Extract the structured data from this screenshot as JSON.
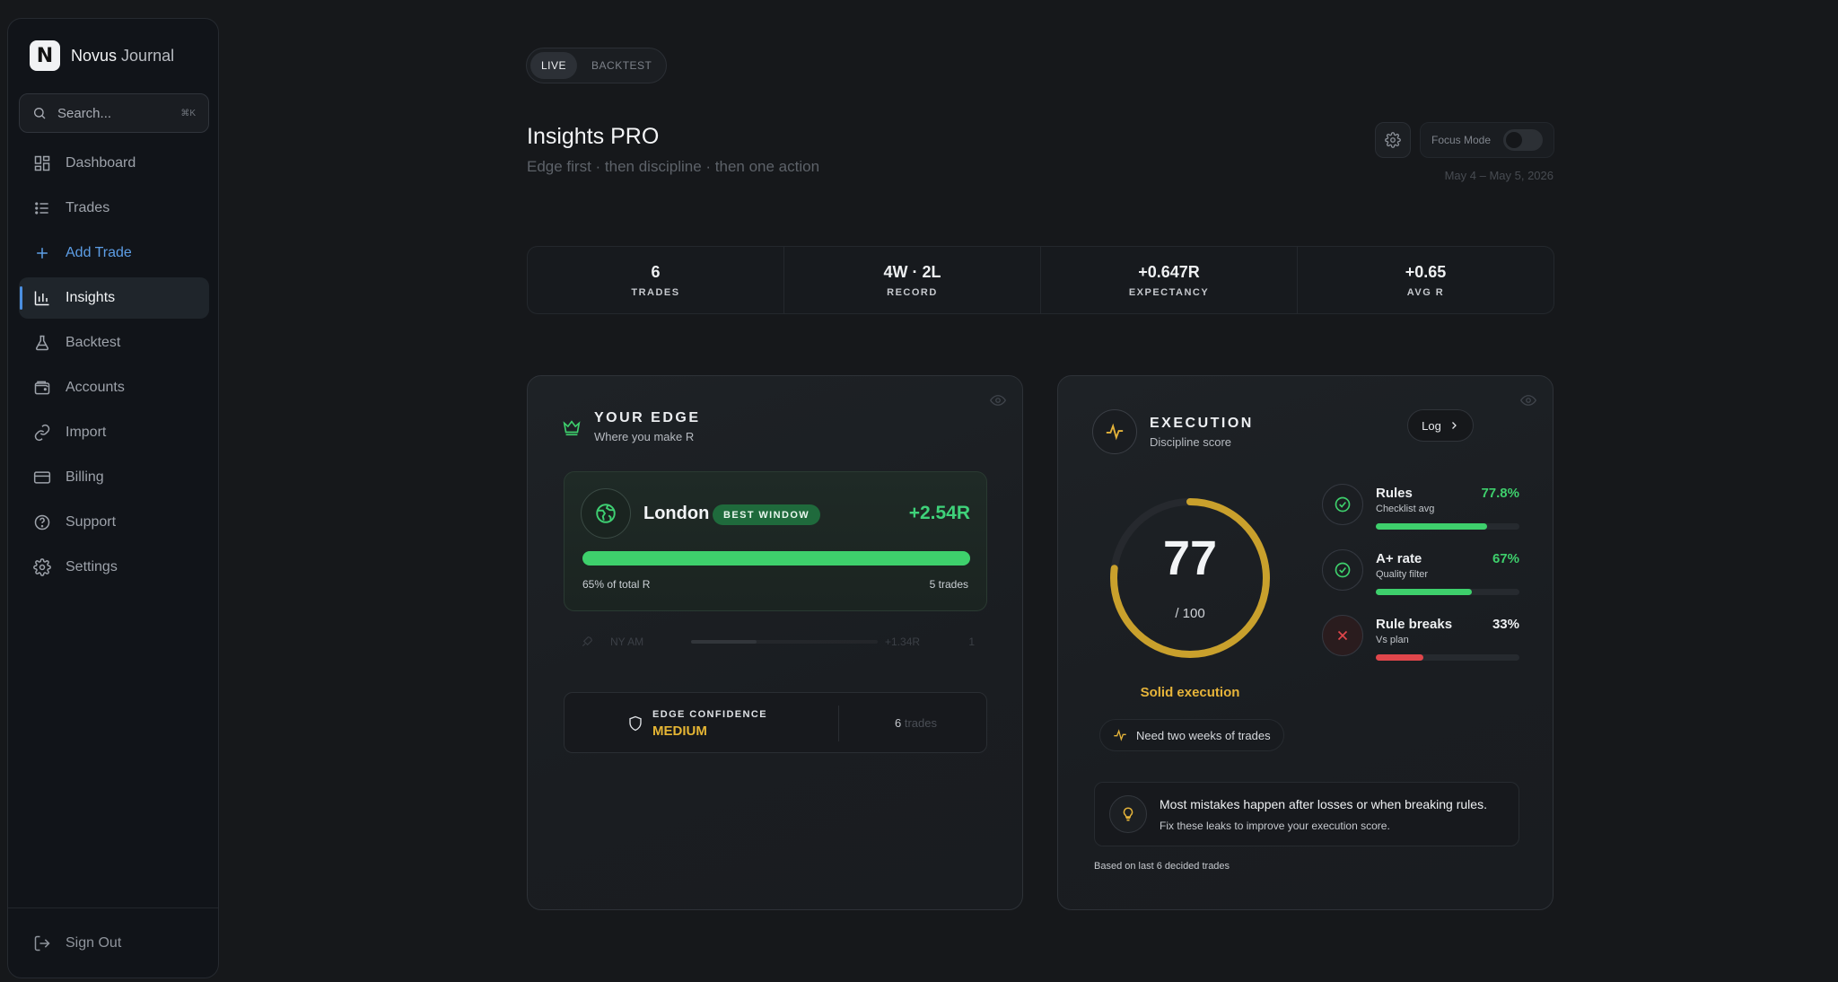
{
  "brand": {
    "logo_letter": "N",
    "name_bold": "Novus",
    "name_light": "Journal"
  },
  "search": {
    "placeholder": "Search...",
    "shortcut": "⌘K"
  },
  "sidebar": {
    "items": [
      {
        "label": "Dashboard",
        "icon": "dashboard-icon"
      },
      {
        "label": "Trades",
        "icon": "list-icon"
      },
      {
        "label": "Add Trade",
        "icon": "plus-icon"
      },
      {
        "label": "Insights",
        "icon": "bar-chart-icon",
        "active": true
      },
      {
        "label": "Backtest",
        "icon": "flask-icon"
      },
      {
        "label": "Accounts",
        "icon": "wallet-icon"
      },
      {
        "label": "Import",
        "icon": "link-icon"
      },
      {
        "label": "Billing",
        "icon": "card-icon"
      },
      {
        "label": "Support",
        "icon": "help-icon"
      },
      {
        "label": "Settings",
        "icon": "gear-icon"
      }
    ],
    "signout": "Sign Out"
  },
  "mode": {
    "live": "LIVE",
    "backtest": "BACKTEST"
  },
  "header": {
    "title": "Insights PRO",
    "subtitle": "Edge first · then discipline · then one action",
    "focus_mode": "Focus Mode",
    "date_range": "May 4 – May 5, 2026"
  },
  "stats": [
    {
      "value": "6",
      "label": "TRADES"
    },
    {
      "value": "4W · 2L",
      "label": "RECORD"
    },
    {
      "value": "+0.647R",
      "label": "EXPECTANCY"
    },
    {
      "value": "+0.65",
      "label": "AVG R"
    }
  ],
  "edge": {
    "title": "YOUR EDGE",
    "subtitle": "Where you make R",
    "best": {
      "session": "London",
      "badge": "BEST WINDOW",
      "r": "+2.54R",
      "share_fraction": 1.0,
      "share_label": "65% of total R",
      "trades_label": "5 trades"
    },
    "secondary": {
      "session": "NY AM",
      "r": "+1.34R",
      "count": "1",
      "fill_fraction": 0.35
    },
    "confidence": {
      "label": "EDGE CONFIDENCE",
      "value": "MEDIUM",
      "trades_count": "6",
      "trades_word": "trades"
    }
  },
  "execution": {
    "title": "EXECUTION",
    "subtitle": "Discipline score",
    "log_label": "Log",
    "score": "77",
    "score_max": "/ 100",
    "score_fraction": 0.77,
    "caption": "Solid execution",
    "chip": "Need two weeks of trades",
    "metrics": [
      {
        "name": "Rules",
        "sub": "Checklist avg",
        "value": "77.8%",
        "fraction": 0.778,
        "color": "#3ecf6c",
        "icon": "check-circle-icon"
      },
      {
        "name": "A+ rate",
        "sub": "Quality filter",
        "value": "67%",
        "fraction": 0.67,
        "color": "#3ecf6c",
        "icon": "check-circle-icon"
      },
      {
        "name": "Rule breaks",
        "sub": "Vs plan",
        "value": "33%",
        "fraction": 0.33,
        "color": "#e0464b",
        "icon": "x-icon"
      }
    ],
    "tip_title": "Most mistakes happen after losses or when breaking rules.",
    "tip_sub": "Fix these leaks to improve your execution score.",
    "based_on": "Based on last 6 decided trades"
  },
  "colors": {
    "accent_blue": "#4b8fe0",
    "green": "#3ecf6c",
    "gold": "#e4b33a",
    "red": "#e0464b"
  }
}
